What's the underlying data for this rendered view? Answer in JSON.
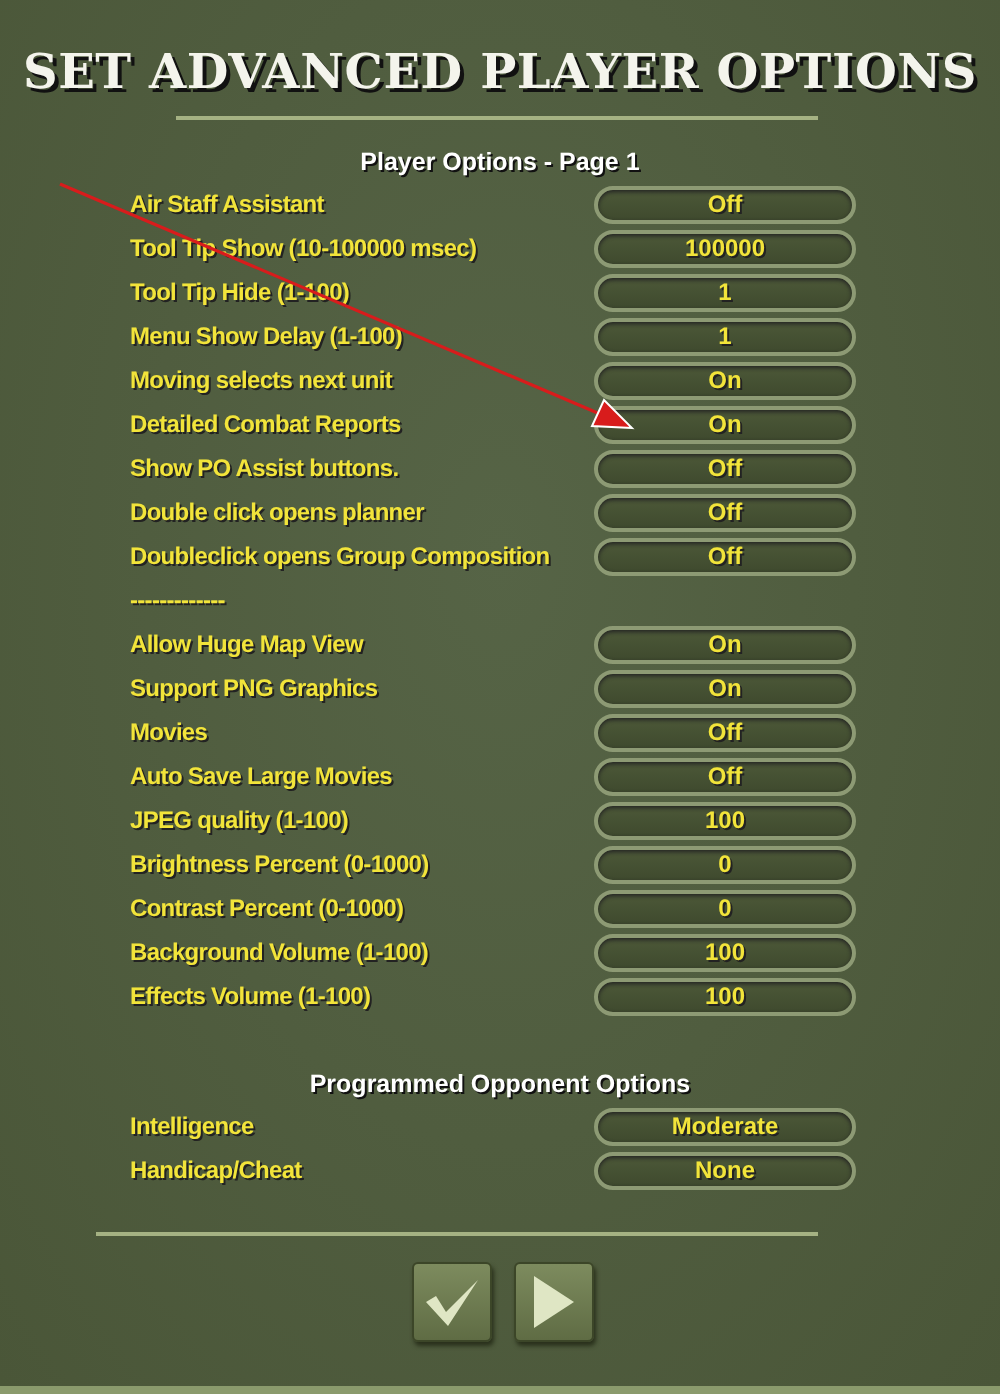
{
  "title": "SET ADVANCED PLAYER OPTIONS",
  "sections": [
    {
      "heading": "Player Options - Page 1",
      "rows": [
        {
          "kind": "option",
          "label": "Air Staff Assistant",
          "value": "Off"
        },
        {
          "kind": "option",
          "label": "Tool Tip Show (10-100000 msec)",
          "value": "100000"
        },
        {
          "kind": "option",
          "label": "Tool Tip Hide (1-100)",
          "value": "1"
        },
        {
          "kind": "option",
          "label": "Menu Show Delay (1-100)",
          "value": "1"
        },
        {
          "kind": "option",
          "label": "Moving selects next unit",
          "value": "On"
        },
        {
          "kind": "option",
          "label": "Detailed Combat Reports",
          "value": "On"
        },
        {
          "kind": "option",
          "label": "Show PO Assist buttons.",
          "value": "Off"
        },
        {
          "kind": "option",
          "label": "Double click opens planner",
          "value": "Off"
        },
        {
          "kind": "option",
          "label": "Doubleclick opens Group Composition",
          "value": "Off"
        },
        {
          "kind": "separator",
          "label": "-------------"
        },
        {
          "kind": "option",
          "label": "Allow Huge Map View",
          "value": "On"
        },
        {
          "kind": "option",
          "label": "Support PNG Graphics",
          "value": "On"
        },
        {
          "kind": "option",
          "label": "Movies",
          "value": "Off"
        },
        {
          "kind": "option",
          "label": "Auto Save Large Movies",
          "value": "Off"
        },
        {
          "kind": "option",
          "label": "JPEG quality (1-100)",
          "value": "100"
        },
        {
          "kind": "option",
          "label": "Brightness Percent (0-1000)",
          "value": "0"
        },
        {
          "kind": "option",
          "label": "Contrast Percent (0-1000)",
          "value": "0"
        },
        {
          "kind": "option",
          "label": "Background Volume (1-100)",
          "value": "100"
        },
        {
          "kind": "option",
          "label": "Effects Volume (1-100)",
          "value": "100"
        }
      ]
    },
    {
      "heading": "Programmed Opponent Options",
      "rows": [
        {
          "kind": "option",
          "label": "Intelligence",
          "value": "Moderate"
        },
        {
          "kind": "option",
          "label": "Handicap/Cheat",
          "value": "None"
        }
      ]
    }
  ],
  "buttons": [
    {
      "kind": "confirm"
    },
    {
      "kind": "next"
    }
  ],
  "annotation": {
    "kind": "arrow"
  }
}
